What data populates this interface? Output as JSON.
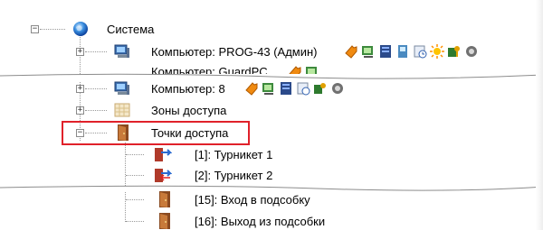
{
  "tree": {
    "root": {
      "label": "Система",
      "expander": "−"
    },
    "computers": [
      {
        "label": "Компьютер: PROG-43 (Админ)",
        "expander": "+"
      },
      {
        "label": "Компьютер: GuardPC",
        "expander": "+"
      },
      {
        "label": "Компьютер: 8",
        "expander": "+"
      }
    ],
    "access_zones": {
      "label": "Зоны доступа",
      "expander": "+"
    },
    "access_points": {
      "label": "Точки доступа",
      "expander": "−"
    },
    "points": [
      {
        "label": "[1]: Турникет 1"
      },
      {
        "label": "[2]: Турникет 2"
      },
      {
        "label": "[15]: Вход в подсобку"
      },
      {
        "label": "[16]: Выход из подсобки"
      }
    ]
  },
  "colors": {
    "selection_border": "#e0212a"
  },
  "icons": {
    "root": "globe-icon",
    "computer": "computer-icon",
    "zones": "zone-grid-icon",
    "access_points": "door-icon",
    "turnstile": "turnstile-icon",
    "door": "door-icon"
  }
}
